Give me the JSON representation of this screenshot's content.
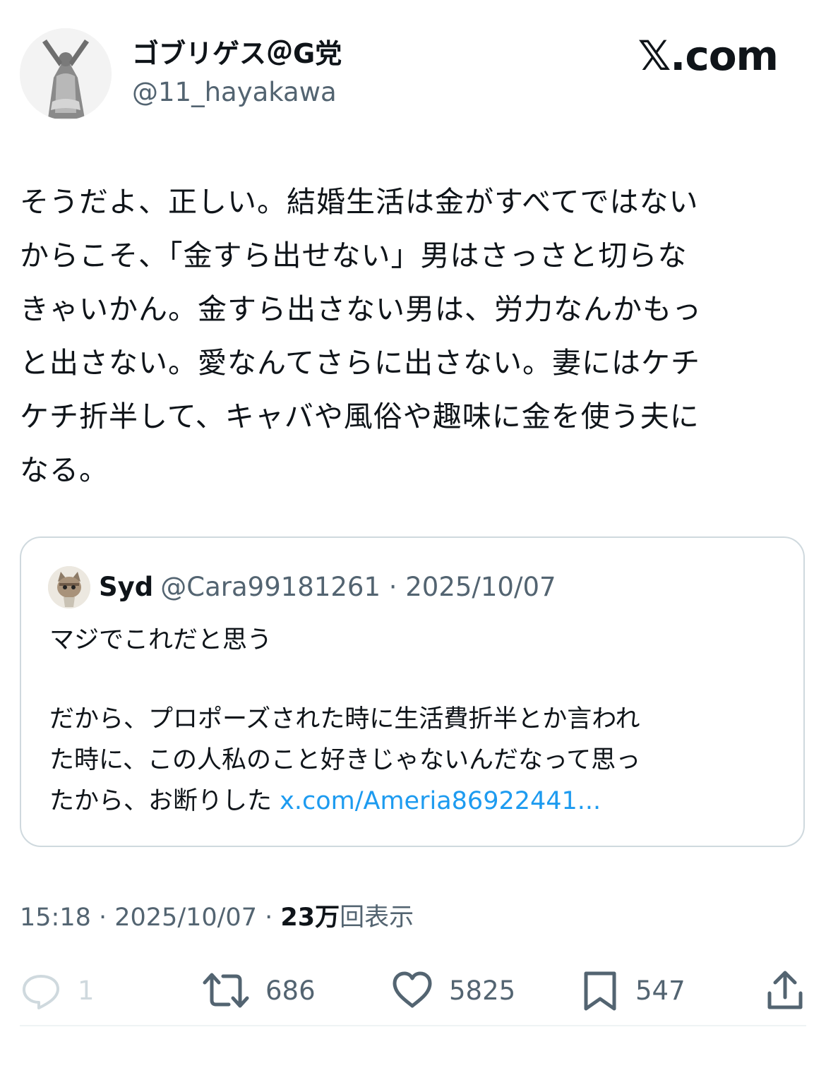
{
  "author": {
    "display_name": "ゴブリゲス＠G党",
    "handle": "@11_hayakawa",
    "avatar_icon": "statue-avatar-icon"
  },
  "site_logo": "𝕏.com",
  "tweet": {
    "lines": [
      "そうだよ、正しい。結婚生活は金がすべてではない",
      "からこそ、「金すら出せない」男はさっさと切らな",
      "きゃいかん。金すら出さない男は、労力なんかもっ",
      "と出さない。愛なんてさらに出さない。妻にはケチ",
      "ケチ折半して、キャバや風俗や趣味に金を使う夫に",
      "なる。"
    ]
  },
  "quote": {
    "name": "Syd",
    "meta": "@Cara99181261 · 2025/10/07",
    "avatar_icon": "cat-avatar-icon",
    "line1": "マジでこれだと思う",
    "line2": "だから、プロポーズされた時に生活費折半とか言われ",
    "line3": "た時に、この人私のこと好きじゃないんだなって思っ",
    "line4_text": "たから、お断りした ",
    "line4_link": "x.com/Ameria86922441..."
  },
  "meta": {
    "time_date": "15:18 · 2025/10/07 · ",
    "views_count": "23万",
    "views_label": "回表示"
  },
  "actions": {
    "replies": "1",
    "reposts": "686",
    "likes": "5825",
    "bookmarks": "547"
  },
  "colors": {
    "text": "#0f1419",
    "secondary": "#536471",
    "link": "#1d9bf0",
    "border": "#cfd9de"
  }
}
